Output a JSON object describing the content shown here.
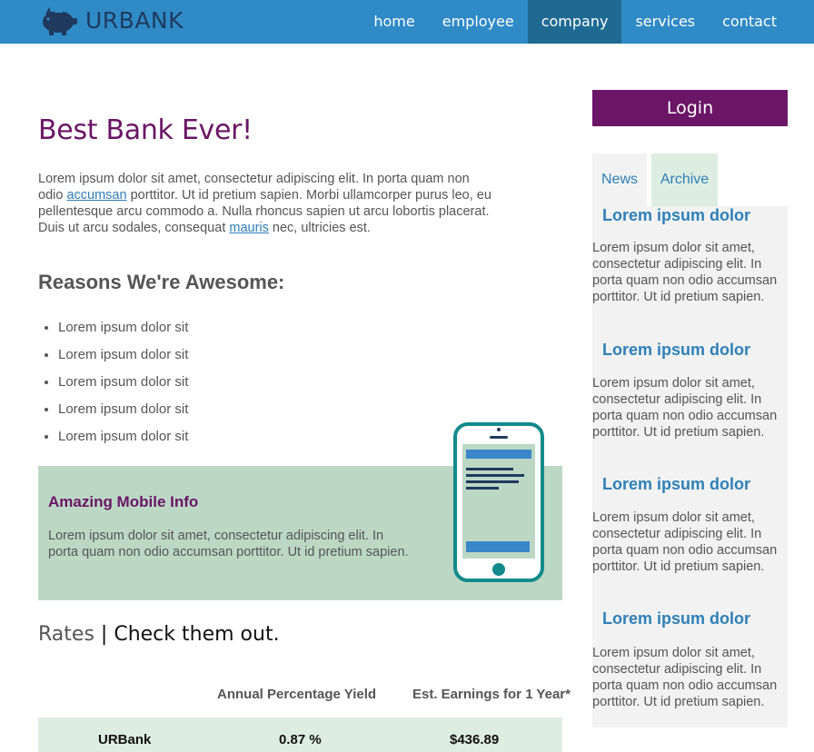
{
  "brand": {
    "name": "URBANK",
    "logo_icon": "piggy-bank-icon"
  },
  "nav": [
    {
      "label": "home",
      "active": false
    },
    {
      "label": "employee",
      "active": false
    },
    {
      "label": "company",
      "active": true
    },
    {
      "label": "services",
      "active": false
    },
    {
      "label": "contact",
      "active": false
    }
  ],
  "main": {
    "title": "Best Bank Ever!",
    "intro": {
      "part1": "Lorem ipsum dolor sit amet, consectetur adipiscing elit. In porta quam non odio ",
      "link1": "accumsan",
      "part2": " porttitor. Ut id pretium sapien. Morbi ullamcorper purus leo, eu pellentesque arcu commodo a. Nulla rhoncus sapien ut arcu lobortis placerat. Duis ut arcu sodales, consequat ",
      "link2": "mauris",
      "part3": " nec, ultricies est."
    },
    "reasons_title": "Reasons We're Awesome:",
    "reasons": [
      "Lorem ipsum dolor sit",
      "Lorem ipsum dolor sit",
      "Lorem ipsum dolor sit",
      "Lorem ipsum dolor sit",
      "Lorem ipsum dolor sit"
    ],
    "mobile": {
      "title": "Amazing Mobile Info",
      "text": "Lorem ipsum dolor sit amet, consectetur adipiscing elit. In porta quam non odio accumsan porttitor. Ut id pretium sapien.",
      "icon": "smartphone-icon"
    },
    "rates": {
      "title_a": "Rates",
      "separator": "|",
      "title_b": "Check them out.",
      "headers": [
        "Annual Percentage Yield",
        "Est. Earnings for 1 Year*"
      ],
      "rows": [
        {
          "bank": "URBank",
          "apy": "0.87 %",
          "earnings": "$436.89"
        }
      ]
    }
  },
  "sidebar": {
    "login_label": "Login",
    "tabs": [
      {
        "label": "News"
      },
      {
        "label": "Archive"
      }
    ],
    "items": [
      {
        "title": "Lorem ipsum dolor",
        "text": "Lorem ipsum dolor sit amet, consectetur adipiscing elit. In porta quam non odio accumsan porttitor. Ut id pretium sapien."
      },
      {
        "title": "Lorem ipsum dolor",
        "text": "Lorem ipsum dolor sit amet, consectetur adipiscing elit. In porta quam non odio accumsan porttitor. Ut id pretium sapien."
      },
      {
        "title": "Lorem ipsum dolor",
        "text": "Lorem ipsum dolor sit amet, consectetur adipiscing elit. In porta quam non odio accumsan porttitor. Ut id pretium sapien."
      },
      {
        "title": "Lorem ipsum dolor",
        "text": "Lorem ipsum dolor sit amet, consectetur adipiscing elit. In porta quam non odio accumsan porttitor. Ut id pretium sapien."
      }
    ]
  },
  "colors": {
    "header_blue": "#2f8ac6",
    "nav_active": "#1f6a93",
    "brand_purple": "#6a1565",
    "mint": "#bcd8c5",
    "link_blue": "#2f7fb8"
  }
}
